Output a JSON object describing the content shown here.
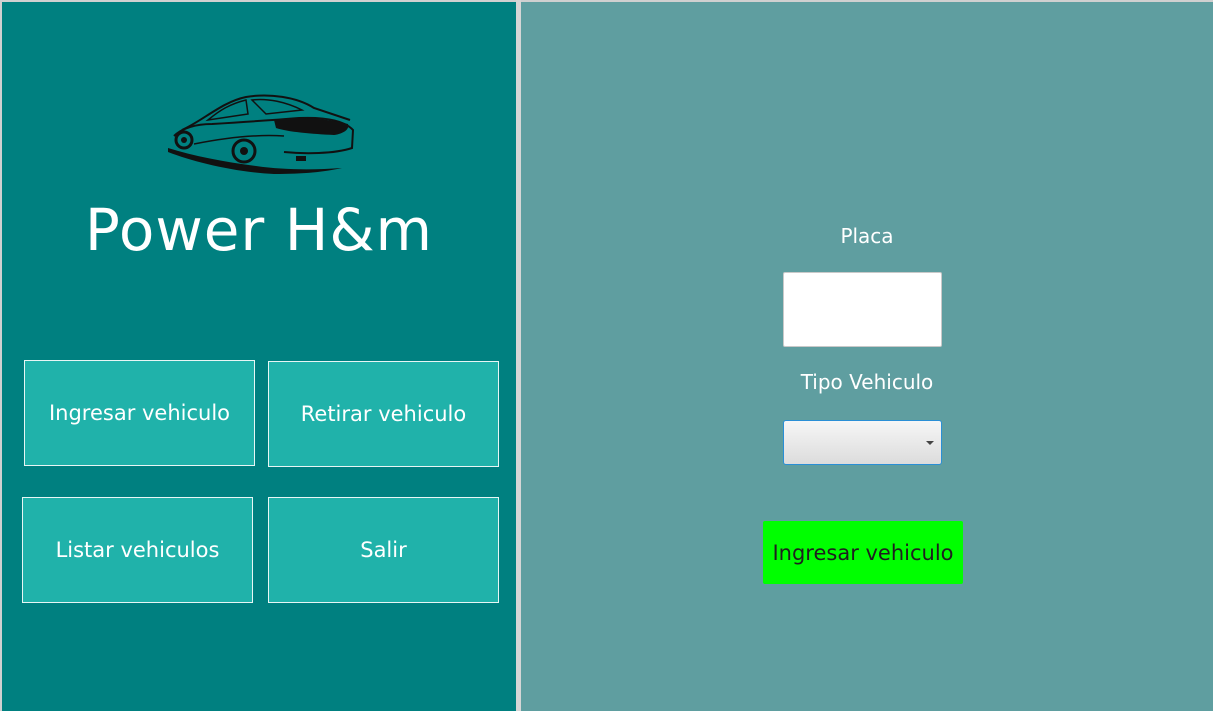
{
  "app": {
    "brand_title": "Power H&m"
  },
  "menu": {
    "ingresar": "Ingresar vehiculo",
    "retirar": "Retirar vehiculo",
    "listar": "Listar vehiculos",
    "salir": "Salir"
  },
  "form": {
    "placa_label": "Placa",
    "placa_value": "",
    "tipo_label": "Tipo Vehiculo",
    "tipo_value": "",
    "submit_label": "Ingresar vehiculo"
  },
  "icons": {
    "logo": "car-icon",
    "dropdown": "chevron-down-icon"
  },
  "colors": {
    "left_panel": "#008080",
    "right_panel": "#5f9ea0",
    "menu_button": "#20b2aa",
    "submit_button": "#00ff00"
  }
}
